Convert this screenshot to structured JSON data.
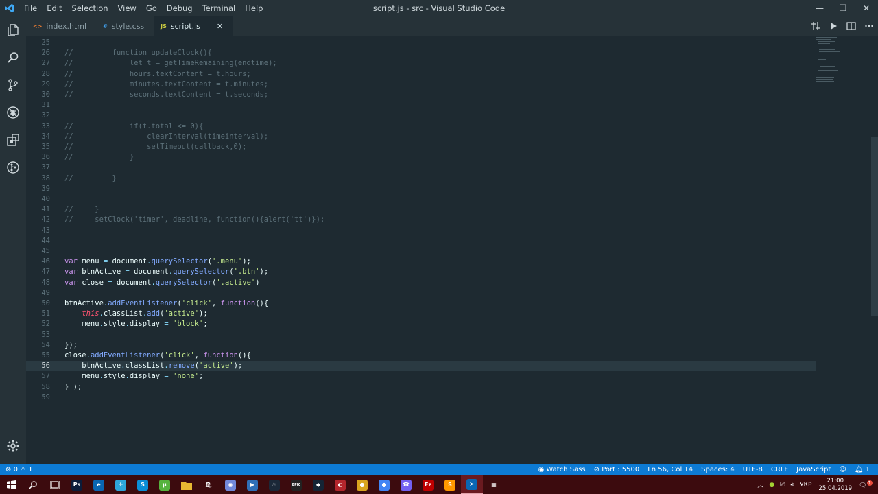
{
  "titlebar": {
    "menu": [
      "File",
      "Edit",
      "Selection",
      "View",
      "Go",
      "Debug",
      "Terminal",
      "Help"
    ],
    "title": "script.js - src - Visual Studio Code",
    "minimize": "—",
    "restore": "❐",
    "close": "✕"
  },
  "tabs": [
    {
      "name": "index.html",
      "icon": "<>",
      "icon_color": "#e37933"
    },
    {
      "name": "style.css",
      "icon": "#",
      "icon_color": "#42a5f5"
    },
    {
      "name": "script.js",
      "icon": "JS",
      "icon_color": "#cbcb41",
      "active": true,
      "close": "✕"
    }
  ],
  "editor": {
    "current_line": "56",
    "lines": [
      {
        "n": "25",
        "t": []
      },
      {
        "n": "26",
        "t": [
          [
            "com",
            "//         function updateClock(){"
          ]
        ]
      },
      {
        "n": "27",
        "t": [
          [
            "com",
            "//             let t = getTimeRemaining(endtime);"
          ]
        ]
      },
      {
        "n": "28",
        "t": [
          [
            "com",
            "//             hours.textContent = t.hours;"
          ]
        ]
      },
      {
        "n": "29",
        "t": [
          [
            "com",
            "//             minutes.textContent = t.minutes;"
          ]
        ]
      },
      {
        "n": "30",
        "t": [
          [
            "com",
            "//             seconds.textContent = t.seconds;"
          ]
        ]
      },
      {
        "n": "31",
        "t": []
      },
      {
        "n": "32",
        "t": []
      },
      {
        "n": "33",
        "t": [
          [
            "com",
            "//             if(t.total <= 0){"
          ]
        ]
      },
      {
        "n": "34",
        "t": [
          [
            "com",
            "//                 clearInterval(timeinterval);"
          ]
        ]
      },
      {
        "n": "35",
        "t": [
          [
            "com",
            "//                 setTimeout(callback,0);"
          ]
        ]
      },
      {
        "n": "36",
        "t": [
          [
            "com",
            "//             }"
          ]
        ]
      },
      {
        "n": "37",
        "t": []
      },
      {
        "n": "38",
        "t": [
          [
            "com",
            "//         }"
          ]
        ]
      },
      {
        "n": "39",
        "t": []
      },
      {
        "n": "40",
        "t": []
      },
      {
        "n": "41",
        "t": [
          [
            "com",
            "//     }"
          ]
        ]
      },
      {
        "n": "42",
        "t": [
          [
            "com",
            "//     setClock('timer', deadline, function(){alert('tt')});"
          ]
        ]
      },
      {
        "n": "43",
        "t": []
      },
      {
        "n": "44",
        "t": []
      },
      {
        "n": "45",
        "t": []
      },
      {
        "n": "46",
        "t": [
          [
            "kw",
            "var"
          ],
          [
            "var",
            " menu "
          ],
          [
            "pun",
            "="
          ],
          [
            "var",
            " document"
          ],
          [
            "pun",
            "."
          ],
          [
            "fn",
            "querySelector"
          ],
          [
            "var",
            "("
          ],
          [
            "str",
            "'.menu'"
          ],
          [
            "var",
            ");"
          ]
        ]
      },
      {
        "n": "47",
        "t": [
          [
            "kw",
            "var"
          ],
          [
            "var",
            " btnActive "
          ],
          [
            "pun",
            "="
          ],
          [
            "var",
            " document"
          ],
          [
            "pun",
            "."
          ],
          [
            "fn",
            "querySelector"
          ],
          [
            "var",
            "("
          ],
          [
            "str",
            "'.btn'"
          ],
          [
            "var",
            ");"
          ]
        ]
      },
      {
        "n": "48",
        "t": [
          [
            "kw",
            "var"
          ],
          [
            "var",
            " close "
          ],
          [
            "pun",
            "="
          ],
          [
            "var",
            " document"
          ],
          [
            "pun",
            "."
          ],
          [
            "fn",
            "querySelector"
          ],
          [
            "var",
            "("
          ],
          [
            "str",
            "'.active'"
          ],
          [
            "var",
            ")"
          ]
        ]
      },
      {
        "n": "49",
        "t": []
      },
      {
        "n": "50",
        "t": [
          [
            "var",
            "btnActive"
          ],
          [
            "pun",
            "."
          ],
          [
            "fn",
            "addEventListener"
          ],
          [
            "var",
            "("
          ],
          [
            "str",
            "'click'"
          ],
          [
            "var",
            ", "
          ],
          [
            "kw",
            "function"
          ],
          [
            "var",
            "(){"
          ]
        ]
      },
      {
        "n": "51",
        "t": [
          [
            "var",
            "    "
          ],
          [
            "this",
            "this"
          ],
          [
            "pun",
            "."
          ],
          [
            "var",
            "classList"
          ],
          [
            "pun",
            "."
          ],
          [
            "fn",
            "add"
          ],
          [
            "var",
            "("
          ],
          [
            "str",
            "'active'"
          ],
          [
            "var",
            ");"
          ]
        ]
      },
      {
        "n": "52",
        "t": [
          [
            "var",
            "    menu"
          ],
          [
            "pun",
            "."
          ],
          [
            "var",
            "style"
          ],
          [
            "pun",
            "."
          ],
          [
            "var",
            "display "
          ],
          [
            "pun",
            "="
          ],
          [
            "var",
            " "
          ],
          [
            "str",
            "'block'"
          ],
          [
            "var",
            ";"
          ]
        ]
      },
      {
        "n": "53",
        "t": []
      },
      {
        "n": "54",
        "t": [
          [
            "var",
            "});"
          ]
        ]
      },
      {
        "n": "55",
        "t": [
          [
            "var",
            "close"
          ],
          [
            "pun",
            "."
          ],
          [
            "fn",
            "addEventListener"
          ],
          [
            "var",
            "("
          ],
          [
            "str",
            "'click'"
          ],
          [
            "var",
            ", "
          ],
          [
            "kw",
            "function"
          ],
          [
            "var",
            "(){"
          ]
        ]
      },
      {
        "n": "56",
        "t": [
          [
            "var",
            "    btnActive"
          ],
          [
            "pun",
            "."
          ],
          [
            "var",
            "classList"
          ],
          [
            "pun",
            "."
          ],
          [
            "fn",
            "remove"
          ],
          [
            "var",
            "("
          ],
          [
            "str",
            "'active'"
          ],
          [
            "var",
            ");"
          ]
        ]
      },
      {
        "n": "57",
        "t": [
          [
            "var",
            "    menu"
          ],
          [
            "pun",
            "."
          ],
          [
            "var",
            "style"
          ],
          [
            "pun",
            "."
          ],
          [
            "var",
            "display "
          ],
          [
            "pun",
            "="
          ],
          [
            "var",
            " "
          ],
          [
            "str",
            "'none'"
          ],
          [
            "var",
            ";"
          ]
        ]
      },
      {
        "n": "58",
        "t": [
          [
            "var",
            "} );"
          ]
        ]
      },
      {
        "n": "59",
        "t": []
      }
    ]
  },
  "statusbar": {
    "errors": "0",
    "warnings": "1",
    "watch_sass": "Watch Sass",
    "port": "Port : 5500",
    "position": "Ln 56, Col 14",
    "spaces": "Spaces: 4",
    "encoding": "UTF-8",
    "eol": "CRLF",
    "language": "JavaScript",
    "notifications": "1"
  },
  "taskbar": {
    "apps": [
      {
        "name": "windows-start",
        "color": "#3c0b0e",
        "label": ""
      },
      {
        "name": "search",
        "color": "#3c0b0e",
        "label": ""
      },
      {
        "name": "task-view",
        "color": "#3c0b0e",
        "label": ""
      },
      {
        "name": "photoshop",
        "color": "#0b1c3a",
        "label": "Ps"
      },
      {
        "name": "edge",
        "color": "#0a66b3",
        "label": "e"
      },
      {
        "name": "telegram",
        "color": "#2ea6da",
        "label": "✈"
      },
      {
        "name": "skype",
        "color": "#0a8ed6",
        "label": "S"
      },
      {
        "name": "utorrent",
        "color": "#56b33e",
        "label": "µ"
      },
      {
        "name": "file-explorer",
        "color": "#e8b832",
        "label": ""
      },
      {
        "name": "store",
        "color": "#3c0b0e",
        "label": "🛍"
      },
      {
        "name": "discord",
        "color": "#7289da",
        "label": "◉"
      },
      {
        "name": "app-blue",
        "color": "#2f6fb8",
        "label": "▶"
      },
      {
        "name": "steam",
        "color": "#1b2838",
        "label": "♨"
      },
      {
        "name": "epic-games",
        "color": "#222222",
        "label": "EPIC"
      },
      {
        "name": "app-dark",
        "color": "#152435",
        "label": "◆"
      },
      {
        "name": "app-red",
        "color": "#b3262c",
        "label": "◐"
      },
      {
        "name": "app-color",
        "color": "#d9a51e",
        "label": "●"
      },
      {
        "name": "chrome",
        "color": "#4285f4",
        "label": "●"
      },
      {
        "name": "viber",
        "color": "#7360f2",
        "label": "☎"
      },
      {
        "name": "filezilla",
        "color": "#bf0000",
        "label": "Fz"
      },
      {
        "name": "sublime",
        "color": "#ff9800",
        "label": "S"
      },
      {
        "name": "vscode",
        "color": "#0a66b3",
        "label": "≻",
        "active": true
      },
      {
        "name": "calculator",
        "color": "#3c0b0e",
        "label": "▦"
      }
    ],
    "tray_lang": "УКР",
    "time": "21:00",
    "date": "25.04.2019",
    "notif_count": "1"
  }
}
